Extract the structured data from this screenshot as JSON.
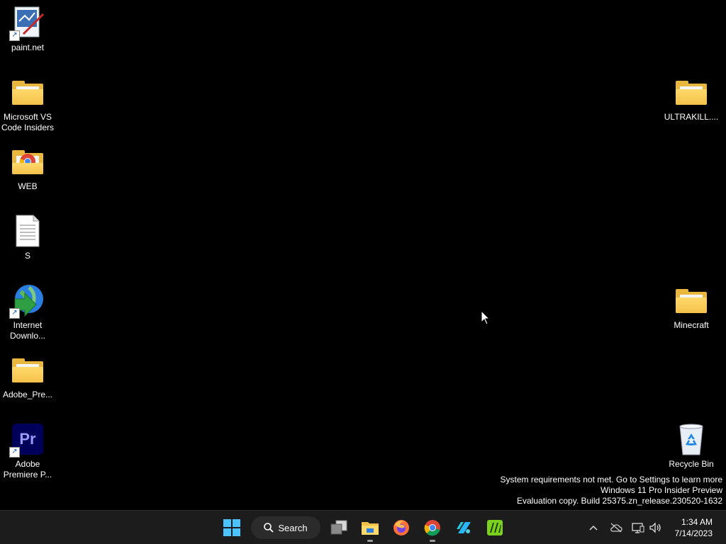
{
  "desktop_icons": {
    "paintnet": {
      "label": "paint.net",
      "icon": "paintnet-icon"
    },
    "vscode": {
      "label": "Microsoft VS\nCode Insiders",
      "icon": "folder-icon"
    },
    "web": {
      "label": "WEB",
      "icon": "folder-chrome-icon"
    },
    "s": {
      "label": "S",
      "icon": "text-file-icon"
    },
    "idm": {
      "label": "Internet\nDownlo...",
      "icon": "internet-download-manager-icon"
    },
    "adobe_pre": {
      "label": "Adobe_Pre...",
      "icon": "folder-icon"
    },
    "premiere": {
      "label": "Adobe\nPremiere P...",
      "icon": "premiere-pro-icon",
      "badge": "Pr"
    },
    "ultrakill": {
      "label": "ULTRAKILL....",
      "icon": "folder-icon"
    },
    "minecraft": {
      "label": "Minecraft",
      "icon": "folder-icon"
    },
    "recycle": {
      "label": "Recycle Bin",
      "icon": "recycle-bin-icon"
    }
  },
  "watermark": {
    "line1": "System requirements not met. Go to Settings to learn more",
    "line2": "Windows 11 Pro Insider Preview",
    "line3": "Evaluation copy. Build 25375.zn_release.230520-1632"
  },
  "taskbar": {
    "search_label": "Search",
    "apps": [
      "start-icon",
      "task-view-icon",
      "file-explorer-icon",
      "firefox-icon",
      "chrome-icon",
      "app-icon",
      "app-icon"
    ]
  },
  "clock": {
    "time": "1:34 AM",
    "date": "7/14/2023"
  },
  "colors": {
    "taskbar": "#1c1c1c",
    "folder": "#f3c14a",
    "start": "#4cc2ff"
  }
}
